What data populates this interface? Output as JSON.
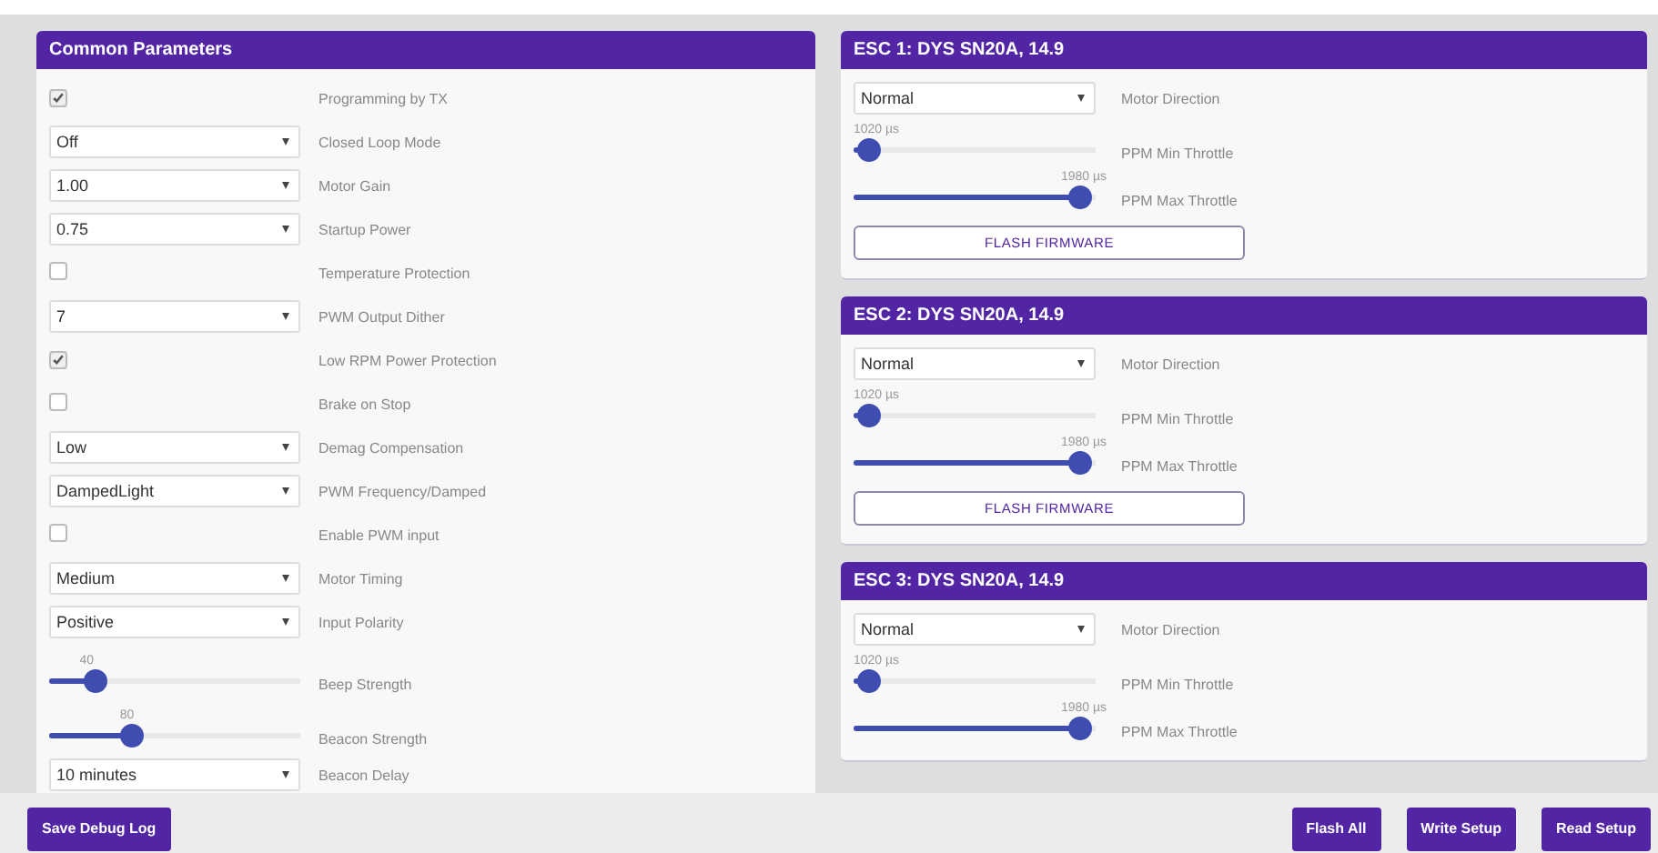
{
  "common": {
    "title": "Common Parameters",
    "rows": [
      {
        "kind": "checkbox",
        "checked": true,
        "label": "Programming by TX"
      },
      {
        "kind": "select",
        "value": "Off",
        "label": "Closed Loop Mode"
      },
      {
        "kind": "select",
        "value": "1.00",
        "label": "Motor Gain"
      },
      {
        "kind": "select",
        "value": "0.75",
        "label": "Startup Power"
      },
      {
        "kind": "checkbox",
        "checked": false,
        "label": "Temperature Protection"
      },
      {
        "kind": "select",
        "value": "7",
        "label": "PWM Output Dither"
      },
      {
        "kind": "checkbox",
        "checked": true,
        "label": "Low RPM Power Protection"
      },
      {
        "kind": "checkbox",
        "checked": false,
        "label": "Brake on Stop"
      },
      {
        "kind": "select",
        "value": "Low",
        "label": "Demag Compensation"
      },
      {
        "kind": "select",
        "value": "DampedLight",
        "label": "PWM Frequency/Damped"
      },
      {
        "kind": "checkbox",
        "checked": false,
        "label": "Enable PWM input"
      },
      {
        "kind": "select",
        "value": "Medium",
        "label": "Motor Timing"
      },
      {
        "kind": "select",
        "value": "Positive",
        "label": "Input Polarity"
      },
      {
        "kind": "slider",
        "reading": "40",
        "level": 0.15,
        "label": "Beep Strength"
      },
      {
        "kind": "slider",
        "reading": "80",
        "level": 0.31,
        "label": "Beacon Strength"
      },
      {
        "kind": "select",
        "value": "10 minutes",
        "label": "Beacon Delay"
      }
    ]
  },
  "escs": [
    {
      "title": "ESC 1: DYS SN20A, 14.9",
      "rows": [
        {
          "kind": "select",
          "value": "Normal",
          "label": "Motor Direction"
        },
        {
          "kind": "slider",
          "reading": "1020 µs",
          "level": 0.02,
          "label": "PPM Min Throttle"
        },
        {
          "kind": "slider",
          "reading": "1980 µs",
          "level": 0.98,
          "label": "PPM Max Throttle"
        }
      ],
      "button": "FLASH FIRMWARE"
    },
    {
      "title": "ESC 2: DYS SN20A, 14.9",
      "rows": [
        {
          "kind": "select",
          "value": "Normal",
          "label": "Motor Direction"
        },
        {
          "kind": "slider",
          "reading": "1020 µs",
          "level": 0.02,
          "label": "PPM Min Throttle"
        },
        {
          "kind": "slider",
          "reading": "1980 µs",
          "level": 0.98,
          "label": "PPM Max Throttle"
        }
      ],
      "button": "FLASH FIRMWARE"
    },
    {
      "title": "ESC 3: DYS SN20A, 14.9",
      "rows": [
        {
          "kind": "select",
          "value": "Normal",
          "label": "Motor Direction"
        },
        {
          "kind": "slider",
          "reading": "1020 µs",
          "level": 0.02,
          "label": "PPM Min Throttle"
        },
        {
          "kind": "slider",
          "reading": "1980 µs",
          "level": 0.98,
          "label": "PPM Max Throttle"
        }
      ]
    }
  ],
  "footer": {
    "left_button": "Save Debug Log",
    "right_buttons": [
      "Flash All",
      "Write Setup",
      "Read Setup"
    ]
  }
}
